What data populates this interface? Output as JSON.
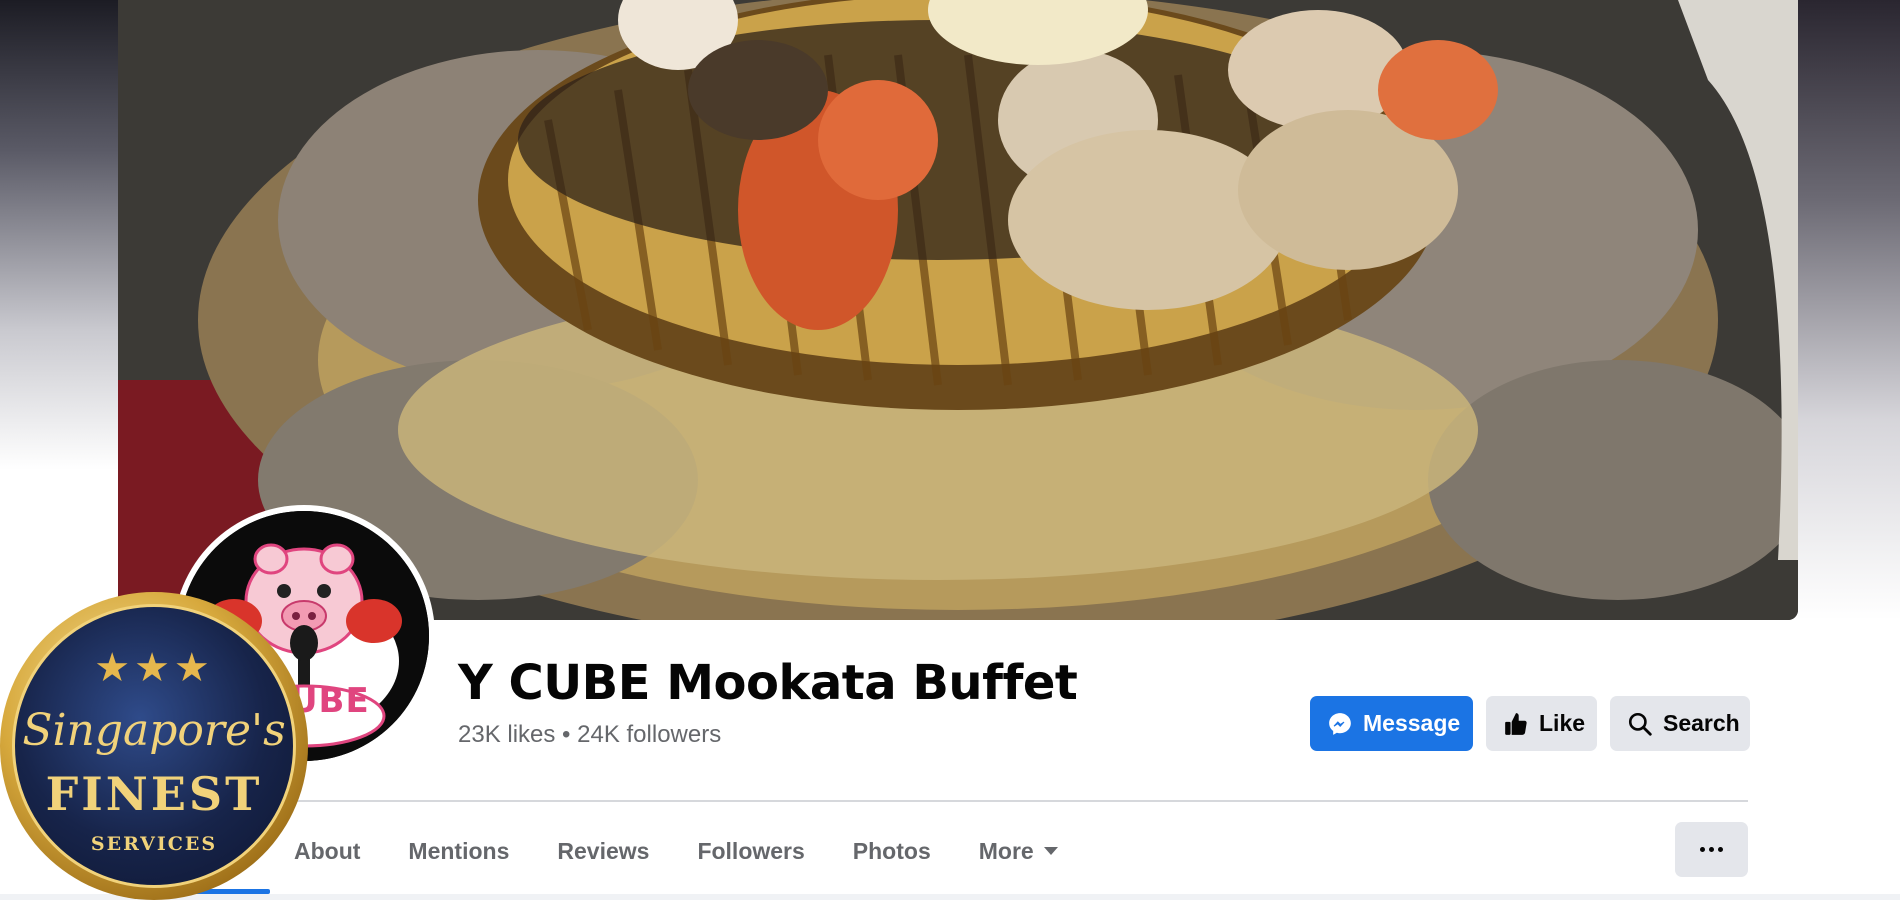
{
  "page": {
    "name": "Y CUBE Mookata Buffet",
    "likes": "23K likes",
    "separator": " • ",
    "followers": "24K followers"
  },
  "avatar": {
    "logo_text": "CUBE"
  },
  "actions": {
    "message_label": "Message",
    "like_label": "Like",
    "search_label": "Search"
  },
  "tabs": [
    {
      "label": "About"
    },
    {
      "label": "Mentions"
    },
    {
      "label": "Reviews"
    },
    {
      "label": "Followers"
    },
    {
      "label": "Photos"
    },
    {
      "label": "More"
    }
  ],
  "badge": {
    "stars": "★★★",
    "line1": "Singapore's",
    "line2": "FINEST",
    "line3": "SERVICES"
  },
  "colors": {
    "accent": "#1b74e4",
    "button_gray": "#e4e6eb",
    "text_primary": "#050505",
    "text_secondary": "#65676b",
    "badge_gold": "#f1d27a",
    "badge_navy": "#17244a"
  },
  "icons": {
    "message": "messenger-icon",
    "like": "thumbs-up-icon",
    "search": "search-icon",
    "more_tab": "caret-down-icon",
    "more_button": "ellipsis-icon"
  }
}
